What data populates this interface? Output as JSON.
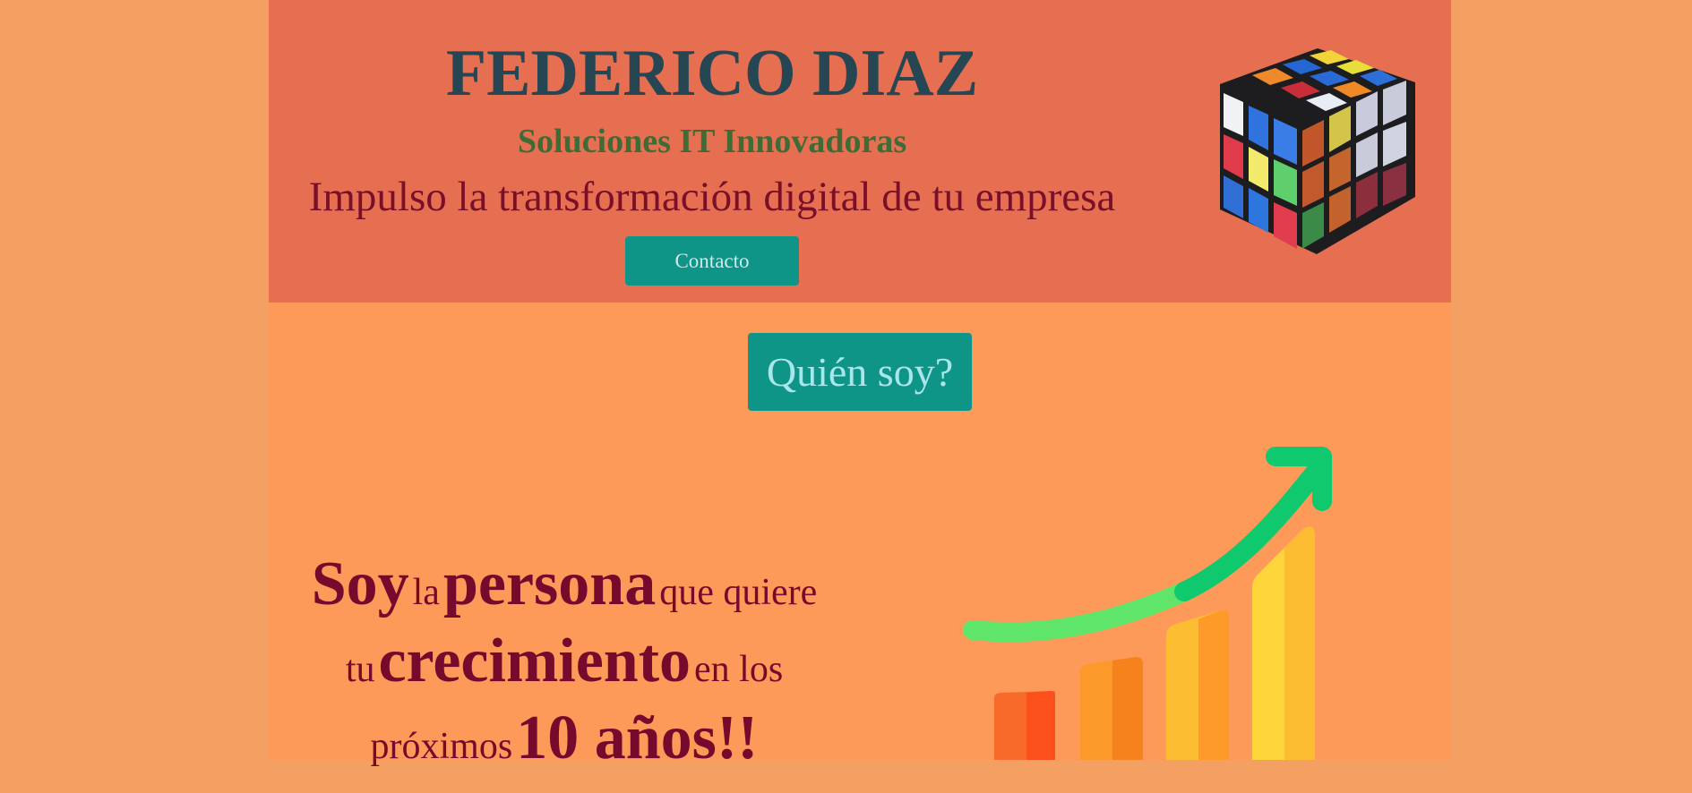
{
  "header": {
    "title": "FEDERICO DIAZ",
    "subtitle": "Soluciones IT Innovadoras",
    "tagline": "Impulso la transformación digital de tu empresa",
    "contact_button": "Contacto",
    "logo_icon": "rubiks-cube-icon"
  },
  "main": {
    "about_button": "Quién soy?",
    "statement": {
      "line1": [
        {
          "text": "Soy",
          "style": "big"
        },
        {
          "text": "la",
          "style": "small"
        },
        {
          "text": "persona",
          "style": "big"
        },
        {
          "text": "que quiere",
          "style": "small"
        }
      ],
      "line2": [
        {
          "text": "tu",
          "style": "small"
        },
        {
          "text": "crecimiento",
          "style": "big"
        },
        {
          "text": "en los",
          "style": "small"
        }
      ],
      "line3": [
        {
          "text": "próximos",
          "style": "small"
        },
        {
          "text": "10 años!!",
          "style": "big"
        }
      ]
    },
    "illustration_icon": "growth-chart-icon"
  },
  "colors": {
    "page_background": "#f4a063",
    "header_background": "#e76f51",
    "main_background": "#fd9a59",
    "title": "#264653",
    "subtitle": "#3f6b37",
    "tagline": "#7a0f2a",
    "button": "#0f9488",
    "statement": "#760a2c"
  }
}
